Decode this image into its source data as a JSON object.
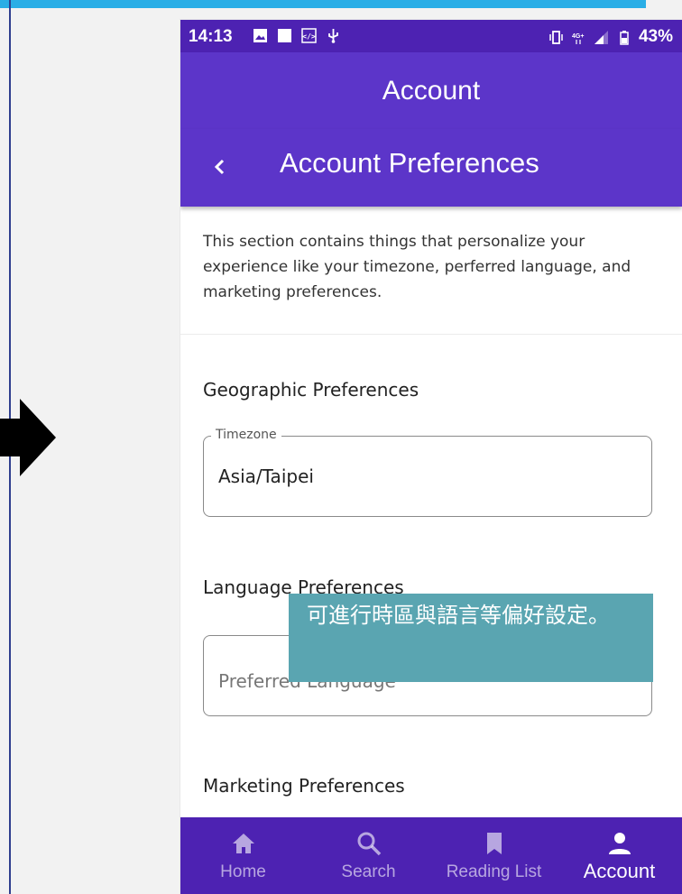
{
  "status_bar": {
    "time": "14:13",
    "battery": "43%"
  },
  "header": {
    "title": "Account"
  },
  "subheader": {
    "title": "Account Preferences"
  },
  "intro_text": "This section contains things that personalize your experience like your timezone, perferred language, and marketing preferences.",
  "geographic": {
    "title": "Geographic Preferences",
    "timezone_label": "Timezone",
    "timezone_value": "Asia/Taipei"
  },
  "language": {
    "title": "Language Preferences",
    "placeholder": "Preferred Language"
  },
  "marketing": {
    "title": "Marketing Preferences"
  },
  "caption": "可進行時區與語言等偏好設定。",
  "bottom_nav": {
    "items": [
      {
        "label": "Home",
        "icon": "home-icon",
        "active": false
      },
      {
        "label": "Search",
        "icon": "search-icon",
        "active": false
      },
      {
        "label": "Reading List",
        "icon": "bookmark-icon",
        "active": false
      },
      {
        "label": "Account",
        "icon": "person-icon",
        "active": true
      }
    ]
  },
  "colors": {
    "status_bar": "#4d22b2",
    "app_bar": "#5c35c9",
    "caption_bg": "#5aa5b1",
    "accent": "#2aaee6"
  }
}
